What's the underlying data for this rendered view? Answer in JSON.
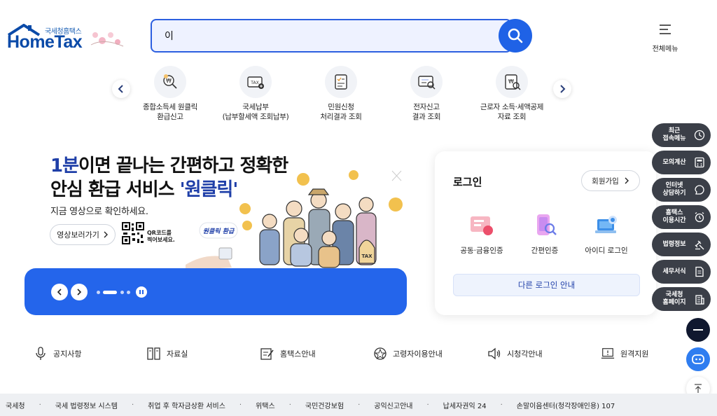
{
  "header": {
    "logo_small": "국세청홈택스",
    "logo_big": "HomeTax",
    "search_value": "이",
    "search_placeholder": "",
    "all_menu_label": "전체메뉴"
  },
  "quick_menu": {
    "items": [
      {
        "label": "종합소득세 원클릭\n환급신고",
        "icon": "refund-icon"
      },
      {
        "label": "국세납부\n(납부할세액 조회납부)",
        "icon": "tax-payment-icon"
      },
      {
        "label": "민원신청\n처리결과 조회",
        "icon": "petition-icon"
      },
      {
        "label": "전자신고\n결과 조회",
        "icon": "e-filing-icon"
      },
      {
        "label": "근로자 소득·세액공제\n자료 조회",
        "icon": "deduction-icon"
      }
    ]
  },
  "banner": {
    "title_highlight": "1분",
    "title_line1_rest": "이면 끝나는 간편하고 정확한",
    "title_line2_pre": "안심 환급 서비스 ",
    "title_line2_highlight": "'원클릭'",
    "subtitle": "지금 영상으로 확인하세요.",
    "video_button": "영상보러가기",
    "qr_text": "QR코드를\n찍어보세요.",
    "badge_text": "원클릭 환급"
  },
  "login": {
    "title": "로그인",
    "join_button": "회원가입",
    "options": [
      {
        "label": "공동·금융인증"
      },
      {
        "label": "간편인증"
      },
      {
        "label": "아이디 로그인"
      }
    ],
    "other_login": "다른 로그인 안내"
  },
  "side_menu": {
    "items": [
      {
        "label": "최근\n접속메뉴",
        "icon": "clock-icon"
      },
      {
        "label": "모의계산",
        "icon": "calculator-icon"
      },
      {
        "label": "인터넷\n상담하기",
        "icon": "chat-icon"
      },
      {
        "label": "홈택스\n이용시간",
        "icon": "alarm-icon"
      },
      {
        "label": "법령정보",
        "icon": "law-icon"
      },
      {
        "label": "세무서식",
        "icon": "form-icon"
      },
      {
        "label": "국세청\n홈페이지",
        "icon": "building-icon"
      }
    ]
  },
  "bottom_links": [
    {
      "label": "공지사항",
      "icon": "microphone-icon"
    },
    {
      "label": "자료실",
      "icon": "archive-icon"
    },
    {
      "label": "홈택스안내",
      "icon": "guide-icon"
    },
    {
      "label": "고령자이용안내",
      "icon": "senior-icon"
    },
    {
      "label": "시청각안내",
      "icon": "speaker-icon"
    },
    {
      "label": "원격지원",
      "icon": "remote-support-icon"
    }
  ],
  "footer_links": [
    "국세청",
    "국세 법령정보 시스템",
    "취업 후 학자금상환 서비스",
    "위택스",
    "국민건강보험",
    "공익신고안내",
    "납세자권익 24",
    "손말이음센터(청각장애인용) 107"
  ],
  "colors": {
    "primary_blue": "#1f62e6",
    "banner_blue": "#2465eb",
    "dark_menu": "#3b3f48"
  }
}
